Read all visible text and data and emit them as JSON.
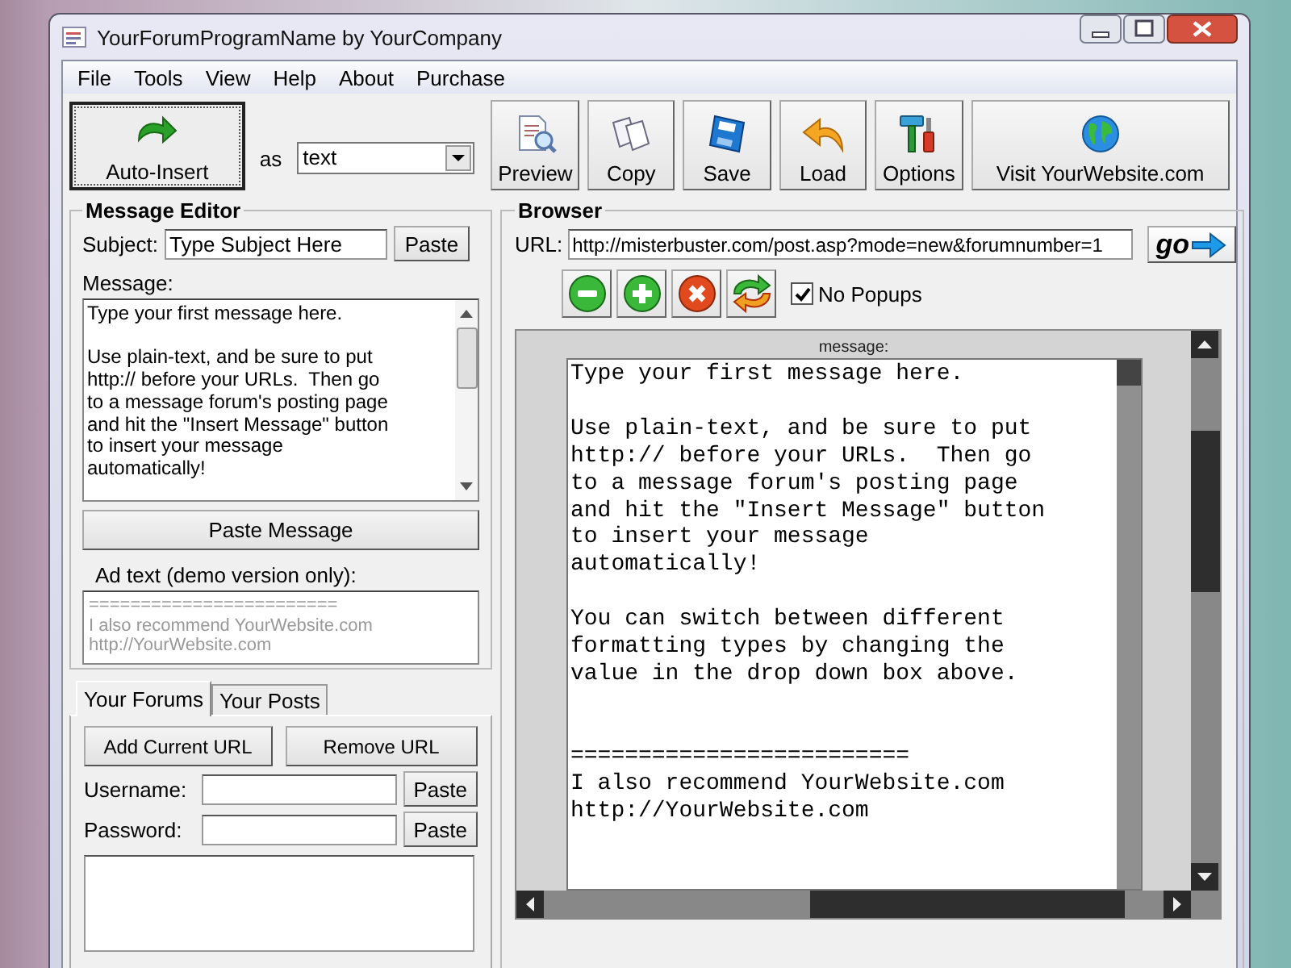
{
  "window": {
    "title": "YourForumProgramName by YourCompany"
  },
  "menu": [
    "File",
    "Tools",
    "View",
    "Help",
    "About",
    "Purchase"
  ],
  "toolbar": {
    "auto_insert": "Auto-Insert",
    "as_label": "as",
    "format": "text",
    "buttons": [
      {
        "kind": "preview",
        "label": "Preview"
      },
      {
        "kind": "copy",
        "label": "Copy"
      },
      {
        "kind": "save",
        "label": "Save"
      },
      {
        "kind": "load",
        "label": "Load"
      },
      {
        "kind": "options",
        "label": "Options"
      },
      {
        "kind": "visit",
        "label": "Visit YourWebsite.com"
      }
    ]
  },
  "message_editor": {
    "title": "Message Editor",
    "subject_label": "Subject:",
    "subject": "Type Subject Here",
    "paste_button": "Paste",
    "message_label": "Message:",
    "message": "Type your first message here.\n\nUse plain-text, and be sure to put\nhttp:// before your URLs.  Then go\nto a message forum's posting page\nand hit the \"Insert Message\" button\nto insert your message\nautomatically!",
    "paste_message_button": "Paste Message",
    "ad_label": "Ad text (demo version only):",
    "ad_text": "========================\nI also recommend YourWebsite.com\nhttp://YourWebsite.com"
  },
  "forums": {
    "tabs": [
      {
        "label": "Your Forums",
        "selected": true
      },
      {
        "label": "Your Posts",
        "selected": false
      }
    ],
    "add_button": "Add Current URL",
    "remove_button": "Remove URL",
    "fields": [
      {
        "label": "Username:",
        "paste_button": "Paste"
      },
      {
        "label": "Password:",
        "paste_button": "Paste"
      }
    ]
  },
  "browser": {
    "title": "Browser",
    "url_label": "URL:",
    "url": "http://misterbuster.com/post.asp?mode=new&forumnumber=1",
    "go_button": "go",
    "nav_buttons": [
      {
        "kind": "minus"
      },
      {
        "kind": "plus"
      },
      {
        "kind": "stop"
      },
      {
        "kind": "refresh"
      }
    ],
    "no_popups": {
      "label": "No Popups",
      "checked": true
    },
    "page": {
      "field_label": "message:",
      "text": "Type your first message here.\n\nUse plain-text, and be sure to put\nhttp:// before your URLs.  Then go\nto a message forum's posting page\nand hit the \"Insert Message\" button\nto insert your message\nautomatically!\n\nYou can switch between different\nformatting types by changing the\nvalue in the drop down box above.\n\n\n=========================\nI also recommend YourWebsite.com\nhttp://YourWebsite.com"
    }
  }
}
